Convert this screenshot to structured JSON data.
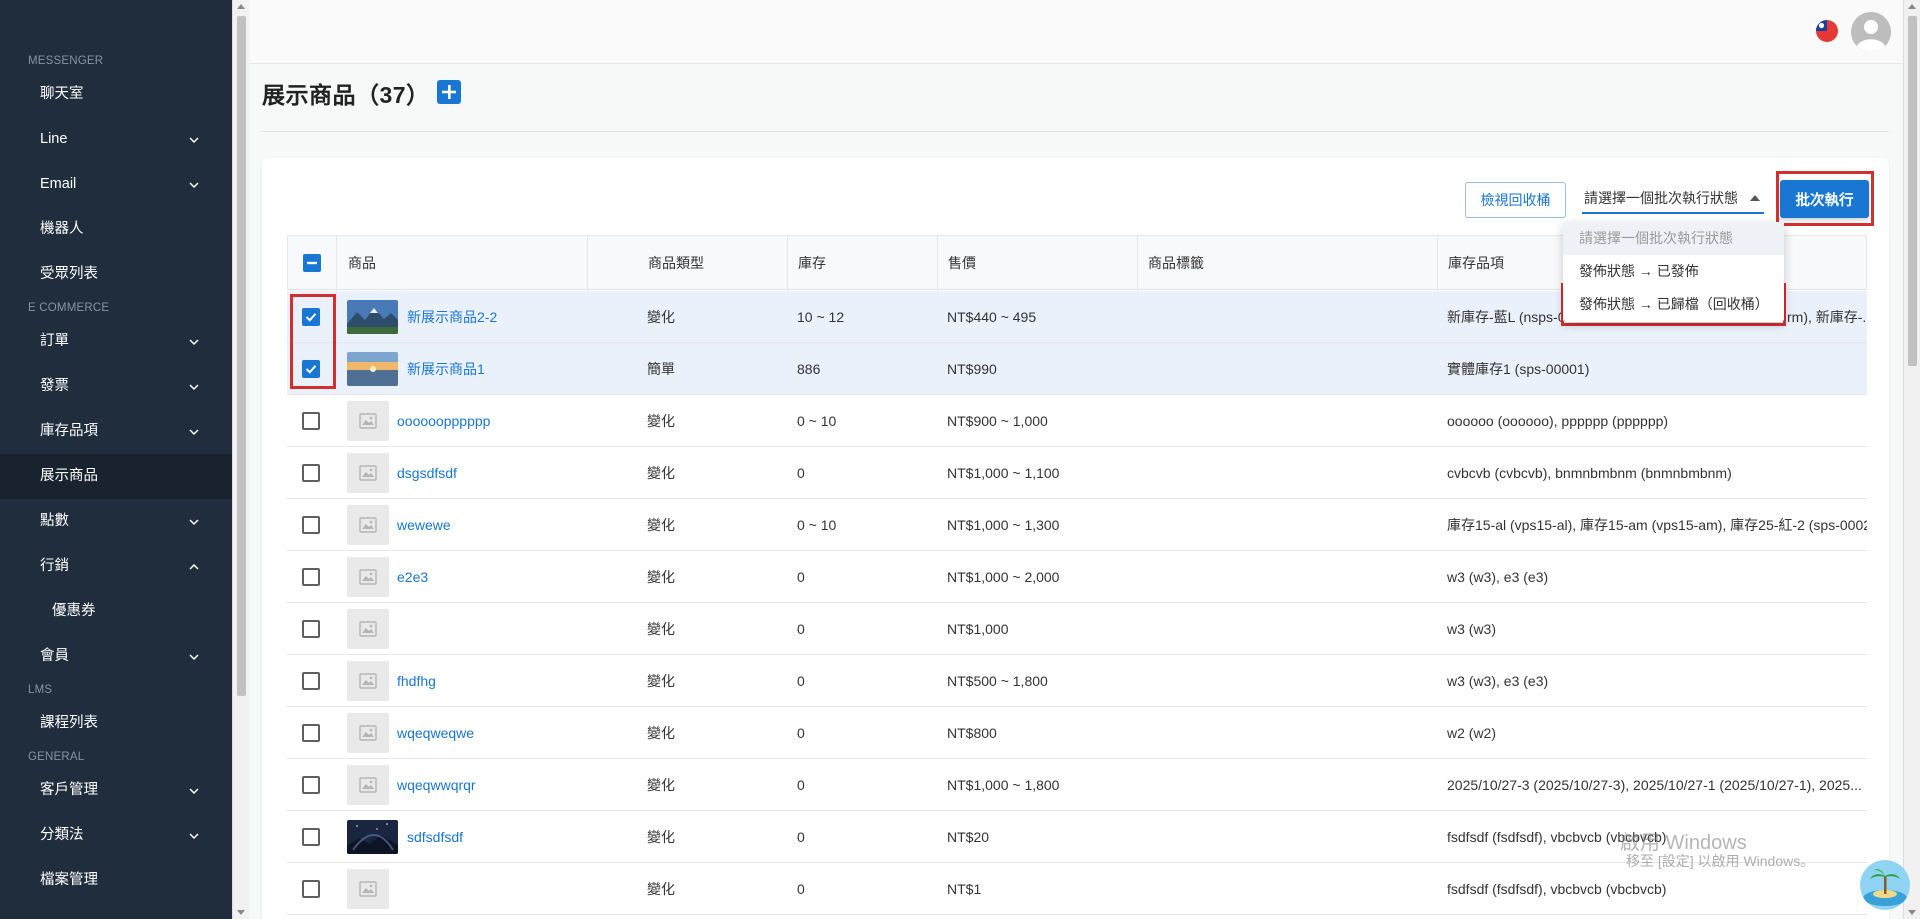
{
  "sidebar": {
    "sections": [
      {
        "label": "MESSENGER",
        "items": [
          {
            "label": "聊天室",
            "chevron": "none"
          },
          {
            "label": "Line",
            "chevron": "down"
          },
          {
            "label": "Email",
            "chevron": "down"
          },
          {
            "label": "機器人",
            "chevron": "none"
          },
          {
            "label": "受眾列表",
            "chevron": "none"
          }
        ]
      },
      {
        "label": "E COMMERCE",
        "items": [
          {
            "label": "訂單",
            "chevron": "down"
          },
          {
            "label": "發票",
            "chevron": "down"
          },
          {
            "label": "庫存品項",
            "chevron": "down"
          },
          {
            "label": "展示商品",
            "chevron": "none",
            "active": true
          },
          {
            "label": "點數",
            "chevron": "down"
          },
          {
            "label": "行銷",
            "chevron": "up"
          },
          {
            "label": "優惠券",
            "chevron": "none",
            "sub": true
          },
          {
            "label": "會員",
            "chevron": "down"
          }
        ]
      },
      {
        "label": "LMS",
        "items": [
          {
            "label": "課程列表",
            "chevron": "none"
          }
        ]
      },
      {
        "label": "GENERAL",
        "items": [
          {
            "label": "客戶管理",
            "chevron": "down"
          },
          {
            "label": "分類法",
            "chevron": "down"
          },
          {
            "label": "檔案管理",
            "chevron": "none"
          }
        ]
      }
    ]
  },
  "header": {
    "title": "展示商品（37）"
  },
  "toolbar": {
    "view_trash_label": "檢視回收桶",
    "batch_select_value": "請選擇一個批次執行狀態",
    "batch_execute_label": "批次執行"
  },
  "dropdown": {
    "options": [
      {
        "label": "請選擇一個批次執行狀態",
        "placeholder": true
      },
      {
        "label": "發佈狀態 → 已發佈"
      },
      {
        "label": "發佈狀態 → 已歸檔（回收桶）"
      }
    ]
  },
  "table": {
    "columns": [
      "商品",
      "商品類型",
      "庫存",
      "售價",
      "商品標籤",
      "庫存品項"
    ],
    "rows": [
      {
        "checked": true,
        "image": "mountains",
        "name": "新展示商品2-2",
        "type": "變化",
        "stock": "10 ~ 12",
        "price": "NT$440 ~ 495",
        "tags": "",
        "items": "新庫存-藍L (nsps-0",
        "items_tail": "rm), 新庫存-..."
      },
      {
        "checked": true,
        "image": "sunset",
        "name": "新展示商品1",
        "type": "簡單",
        "stock": "886",
        "price": "NT$990",
        "tags": "",
        "items": "實體庫存1 (sps-00001)"
      },
      {
        "checked": false,
        "image": "placeholder",
        "name": "oooooopppppp",
        "type": "變化",
        "stock": "0 ~ 10",
        "price": "NT$900 ~ 1,000",
        "tags": "",
        "items": "oooooo (oooooo), pppppp (pppppp)"
      },
      {
        "checked": false,
        "image": "placeholder",
        "name": "dsgsdfsdf",
        "type": "變化",
        "stock": "0",
        "price": "NT$1,000 ~ 1,100",
        "tags": "",
        "items": "cvbcvb (cvbcvb), bnmnbmbnm (bnmnbmbnm)"
      },
      {
        "checked": false,
        "image": "placeholder",
        "name": "wewewe",
        "type": "變化",
        "stock": "0 ~ 10",
        "price": "NT$1,000 ~ 1,300",
        "tags": "",
        "items": "庫存15-al (vps15-al), 庫存15-am (vps15-am), 庫存25-紅-2 (sps-0002"
      },
      {
        "checked": false,
        "image": "placeholder",
        "name": "e2e3",
        "type": "變化",
        "stock": "0",
        "price": "NT$1,000 ~ 2,000",
        "tags": "",
        "items": "w3 (w3), e3 (e3)"
      },
      {
        "checked": false,
        "image": "placeholder",
        "name": "",
        "type": "變化",
        "stock": "0",
        "price": "NT$1,000",
        "tags": "",
        "items": "w3 (w3)"
      },
      {
        "checked": false,
        "image": "placeholder",
        "name": "fhdfhg",
        "type": "變化",
        "stock": "0",
        "price": "NT$500 ~ 1,800",
        "tags": "",
        "items": "w3 (w3), e3 (e3)"
      },
      {
        "checked": false,
        "image": "placeholder",
        "name": "wqeqweqwe",
        "type": "變化",
        "stock": "0",
        "price": "NT$800",
        "tags": "",
        "items": "w2 (w2)"
      },
      {
        "checked": false,
        "image": "placeholder",
        "name": "wqeqwwqrqr",
        "type": "變化",
        "stock": "0",
        "price": "NT$1,000 ~ 1,800",
        "tags": "",
        "items": "2025/10/27-3 (2025/10/27-3), 2025/10/27-1 (2025/10/27-1), 2025..."
      },
      {
        "checked": false,
        "image": "night",
        "name": "sdfsdfsdf",
        "type": "變化",
        "stock": "0",
        "price": "NT$20",
        "tags": "",
        "items": "fsdfsdf (fsdfsdf), vbcbvcb (vbcbvcb)"
      },
      {
        "checked": false,
        "image": "placeholder",
        "name": "",
        "type": "變化",
        "stock": "0",
        "price": "NT$1",
        "tags": "",
        "items": "fsdfsdf (fsdfsdf), vbcbvcb (vbcbvcb)"
      }
    ]
  },
  "watermark": {
    "line1": "啟用 Windows",
    "line2": "移至 [設定] 以啟用 Windows。"
  },
  "colors": {
    "accent": "#1976d2",
    "sidebar_bg": "#1f2d3d",
    "highlight_red": "#d32f2f",
    "selected_row": "#eaf1fa"
  }
}
